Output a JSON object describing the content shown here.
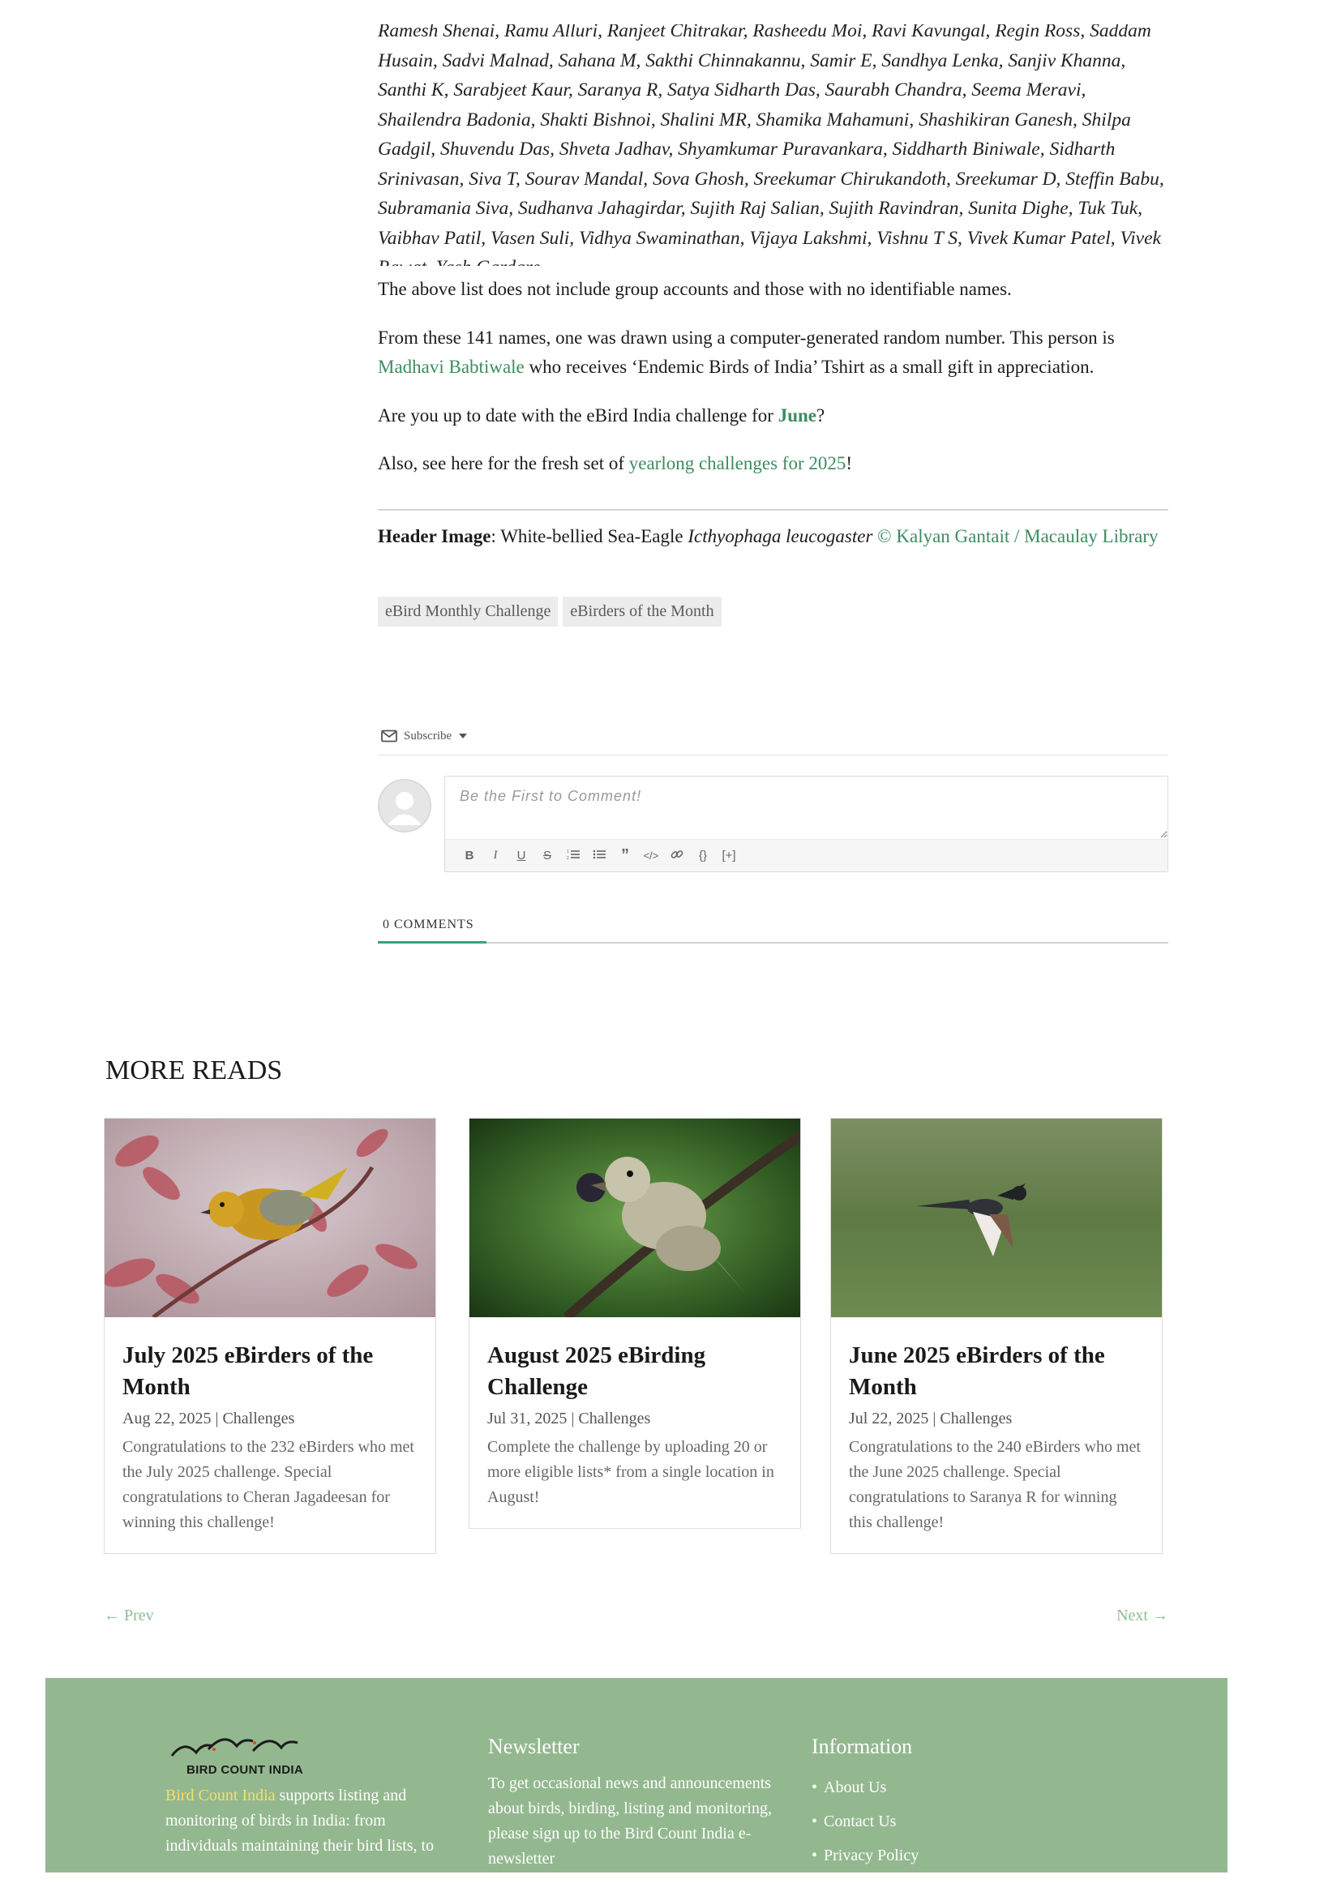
{
  "article": {
    "names_list": "Ramesh Shenai, Ramu Alluri, Ranjeet Chitrakar, Rasheedu Moi, Ravi Kavungal, Regin Ross, Saddam Husain, Sadvi Malnad, Sahana M, Sakthi Chinnakannu, Samir E, Sandhya Lenka, Sanjiv Khanna, Santhi K, Sarabjeet Kaur, Saranya R, Satya Sidharth Das, Saurabh Chandra, Seema Meravi, Shailendra Badonia, Shakti Bishnoi, Shalini MR, Shamika Mahamuni, Shashikiran Ganesh, Shilpa Gadgil, Shuvendu Das, Shveta Jadhav, Shyamkumar Puravankara, Siddharth Biniwale, Sidharth Srinivasan, Siva T, Sourav Mandal, Sova Ghosh, Sreekumar Chirukandoth, Sreekumar D, Steffin Babu, Subramania Siva, Sudhanva Jahagirdar, Sujith Raj Salian, Sujith Ravindran, Sunita Dighe, Tuk Tuk, Vaibhav Patil, Vasen Suli, Vidhya Swaminathan, Vijaya Lakshmi, Vishnu T S, Vivek Kumar Patel, Vivek Rawat, Yash Gardare.",
    "p_group_note": "The above list does not include group accounts and those with no identifiable names.",
    "p_draw_a": "From these 141 names, one was drawn using a computer-generated random number. This person is",
    "winner_name": "Madhavi Babtiwale",
    "p_draw_b": "who receives ‘Endemic Birds of India’ Tshirt as a small gift in appreciation.",
    "p_uptodate_a": "Are you up to date with the eBird India challenge for",
    "june_link": "June",
    "p_uptodate_b": "?",
    "p_also_a": "Also, see here for the fresh set of",
    "yearlong_link": "yearlong challenges for 2025",
    "p_also_b": "!",
    "header_label": "Header Image",
    "header_colon": ": White-bellied Sea-Eagle ",
    "header_species": "Icthyophaga leucogaster",
    "header_credit": " © Kalyan Gantait / Macaulay Library",
    "tags": [
      "eBird Monthly Challenge",
      "eBirders of the Month"
    ]
  },
  "comments": {
    "subscribe_label": "Subscribe",
    "placeholder": "Be the First to Comment!",
    "toolbar": [
      "B",
      "I",
      "U",
      "S",
      "ol",
      "ul",
      "quote",
      "code",
      "link",
      "{}",
      "[+]"
    ],
    "tab_label": "0 COMMENTS"
  },
  "more_reads": {
    "title": "MORE READS",
    "cards": [
      {
        "title": "July 2025 eBirders of the Month",
        "date": "Aug 22, 2025",
        "category": "Challenges",
        "excerpt": "Congratulations to the 232 eBirders who met the July 2025 challenge. Special congratulations to Cheran Jagadeesan for winning this challenge!"
      },
      {
        "title": "August 2025 eBirding Challenge",
        "date": "Jul 31, 2025",
        "category": "Challenges",
        "excerpt": "Complete the challenge by uploading 20 or more eligible lists* from a single location in August!"
      },
      {
        "title": "June 2025 eBirders of the Month",
        "date": "Jul 22, 2025",
        "category": "Challenges",
        "excerpt": "Congratulations to the 240 eBirders who met the June 2025 challenge. Special congratulations to Saranya R for winning this challenge!"
      }
    ],
    "prev": "← Prev",
    "next": "Next →"
  },
  "footer": {
    "logo_text": "BIRD COUNT INDIA",
    "about_highlight": "Bird Count India",
    "about_rest": " supports listing and monitoring of birds in India: from individuals maintaining their bird lists, to",
    "newsletter_heading": "Newsletter",
    "newsletter_text": "To get occasional news and announcements about birds, birding, listing and monitoring, please sign up to the Bird Count India e-newsletter",
    "info_heading": "Information",
    "info_links": [
      "About Us",
      "Contact Us",
      "Privacy Policy"
    ]
  },
  "colors": {
    "link_green": "#3d8c5f",
    "footer_bg": "#93b88f",
    "tab_accent": "#3aa07f"
  }
}
